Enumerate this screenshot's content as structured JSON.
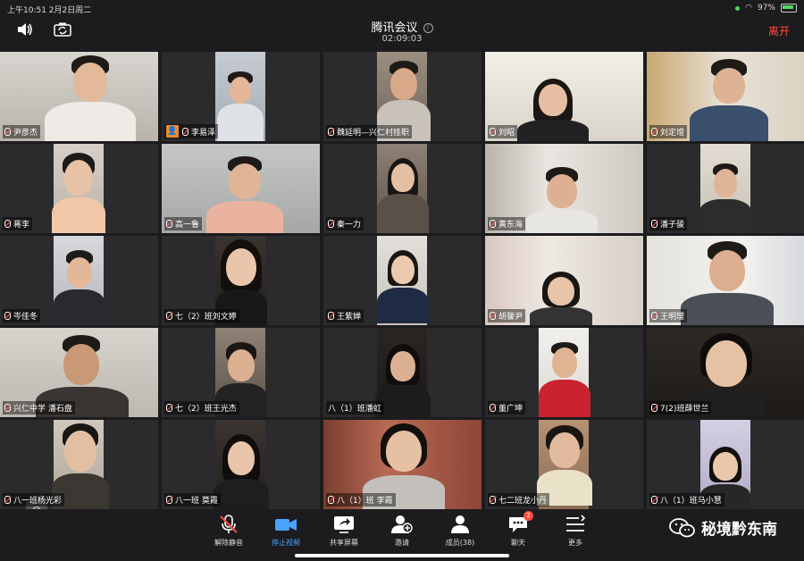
{
  "status_bar": {
    "time": "上午10:51   2月2日周二",
    "battery": "97%"
  },
  "header": {
    "title": "腾讯会议",
    "duration": "02:09:03",
    "leave": "离开"
  },
  "participants": [
    {
      "name": "尹彦杰"
    },
    {
      "name": "李易泽"
    },
    {
      "name": "魏延明—兴仁村挂职"
    },
    {
      "name": "刘昭"
    },
    {
      "name": "刘定增"
    },
    {
      "name": "蒋李"
    },
    {
      "name": "高一鲁"
    },
    {
      "name": "秦一力"
    },
    {
      "name": "黄东海"
    },
    {
      "name": "潘子骏"
    },
    {
      "name": "岑佳冬"
    },
    {
      "name": "七（2）班刘文婷"
    },
    {
      "name": "王紫婵"
    },
    {
      "name": "胡馨尹"
    },
    {
      "name": "王明理"
    },
    {
      "name": "兴仁中学  潘石盘"
    },
    {
      "name": "七（2）班王光杰"
    },
    {
      "name": "八（1）班潘虹"
    },
    {
      "name": "董广坤"
    },
    {
      "name": "7(2)班薛世兰"
    },
    {
      "name": "八一班杨光彩"
    },
    {
      "name": "八一班  莫霞"
    },
    {
      "name": "八（1）班   李霞"
    },
    {
      "name": "七二班龙小丹"
    },
    {
      "name": "八（1）班马小慧"
    }
  ],
  "toolbar": {
    "unmute": "解除静音",
    "stop_video": "停止视频",
    "share_screen": "共享屏幕",
    "invite": "邀请",
    "members": "成员(38)",
    "chat": "聊天",
    "chat_badge": "2",
    "more": "更多"
  },
  "watermark": "秘境黔东南",
  "colors": {
    "accent": "#4aa3ff",
    "leave": "#ff4d3d",
    "host": "#f08b2a"
  }
}
